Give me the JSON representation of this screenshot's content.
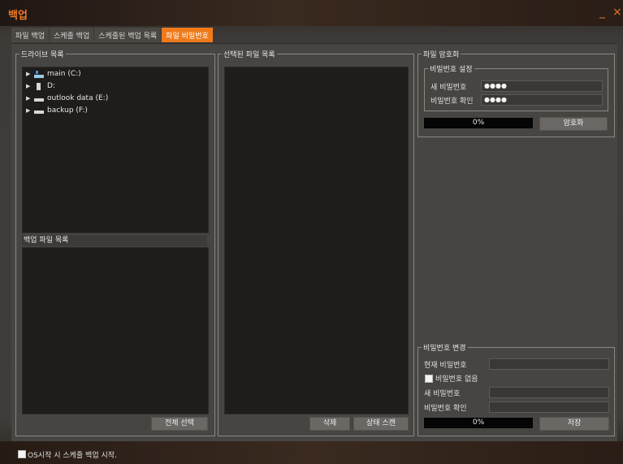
{
  "app": {
    "title": "백업",
    "minimize": "_",
    "close": "×"
  },
  "tabs": [
    "파일 백업",
    "스케줄 백업",
    "스케줄된 백업 목록",
    "파일 비밀번호"
  ],
  "drive_panel": {
    "title": "드라이브 목록",
    "drives": [
      {
        "label": "main (C:)",
        "icon": "system-drive-icon"
      },
      {
        "label": "D:",
        "icon": "usb-drive-icon"
      },
      {
        "label": "outlook data (E:)",
        "icon": "hard-drive-icon"
      },
      {
        "label": "backup (F:)",
        "icon": "hard-drive-icon"
      }
    ],
    "backup_list_title": "백업 파일 목록",
    "select_all": "전체 선택"
  },
  "selected_panel": {
    "title": "선택된 파일 목록",
    "delete": "삭제",
    "status_scan": "상태 스캔"
  },
  "encrypt_panel": {
    "title": "파일 암호화",
    "pw_group_title": "비밀번호 설정",
    "new_pw_label": "새 비밀번호",
    "new_pw_value": "●●●●",
    "confirm_pw_label": "비밀번호 확인",
    "confirm_pw_value": "●●●●",
    "progress": "0%",
    "progress_value": 0,
    "encrypt_button": "암호화"
  },
  "change_panel": {
    "title": "비밀번호 변경",
    "current_pw_label": "현재 비밀번호",
    "no_pw_label": "비밀번호 없음",
    "new_pw_label": "새 비밀번호",
    "confirm_pw_label": "비밀번호 확인",
    "progress": "0%",
    "progress_value": 0,
    "save_button": "저장"
  },
  "footer": {
    "os_start_label": "OS시작 시 스케줄 백업 시작."
  },
  "colors": {
    "accent": "#f07a1a",
    "title": "#f07a2a",
    "panel_dark": "#1e1d1c",
    "background": "#474542"
  }
}
